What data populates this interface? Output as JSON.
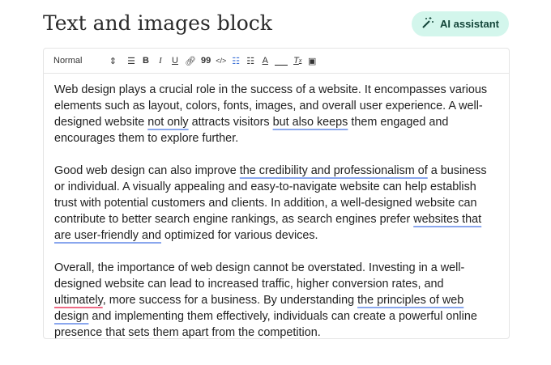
{
  "header": {
    "title": "Text and images block",
    "ai_button": "AI assistant"
  },
  "toolbar": {
    "format": "Normal",
    "items": [
      "align-icon",
      "bold-icon",
      "italic-icon",
      "underline-icon",
      "link-icon",
      "quote-icon",
      "code-icon",
      "bullet-list-icon",
      "ordered-list-icon",
      "text-color-icon",
      "highlight-icon",
      "clear-format-icon",
      "image-icon"
    ],
    "active": "bullet-list-icon",
    "accent": "#3b6fd6"
  },
  "colors": {
    "grammar_underline": "#8aa7ee",
    "spelling_underline": "#ef6b86",
    "ai_bg": "#d3f6ec"
  },
  "content": {
    "paragraphs": [
      [
        {
          "t": "Web design plays a crucial role in the success of a website. It encompasses various elements such as layout, colors, fonts, images, and overall user experience. A well-designed website "
        },
        {
          "t": "not only",
          "m": "g"
        },
        {
          "t": " attracts visitors "
        },
        {
          "t": "but also keeps",
          "m": "g"
        },
        {
          "t": " them engaged and encourages them to explore further."
        }
      ],
      [
        {
          "t": "Good web design can also improve "
        },
        {
          "t": "the credibility and professionalism of",
          "m": "g"
        },
        {
          "t": " a business or individual. A visually appealing and easy-to-navigate website can help establish trust with potential customers and clients. In addition, a well-designed website can contribute to better search engine rankings, as search engines prefer "
        },
        {
          "t": "websites that are user-friendly and",
          "m": "g"
        },
        {
          "t": " optimized for various devices."
        }
      ],
      [
        {
          "t": "Overall, the importance of web design cannot be overstated. Investing in a well-designed website can lead to increased traffic, higher conversion rates, and "
        },
        {
          "t": "ultimately",
          "m": "s"
        },
        {
          "t": ", more success for a business. By understanding "
        },
        {
          "t": "the principles of web design",
          "m": "g"
        },
        {
          "t": " and implementing them effectively, individuals can create a powerful online presence that sets them apart from the competition."
        }
      ]
    ]
  }
}
